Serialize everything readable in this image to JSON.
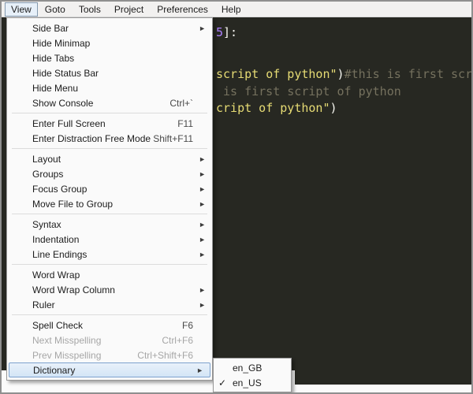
{
  "menubar": {
    "active": "View",
    "items": [
      "View",
      "Goto",
      "Tools",
      "Project",
      "Preferences",
      "Help"
    ]
  },
  "view_menu": {
    "items": [
      {
        "label": "Side Bar",
        "arrow": true
      },
      {
        "label": "Hide Minimap"
      },
      {
        "label": "Hide Tabs"
      },
      {
        "label": "Hide Status Bar"
      },
      {
        "label": "Hide Menu"
      },
      {
        "label": "Show Console",
        "shortcut": "Ctrl+`"
      },
      {
        "separator": true
      },
      {
        "label": "Enter Full Screen",
        "shortcut": "F11"
      },
      {
        "label": "Enter Distraction Free Mode",
        "shortcut": "Shift+F11"
      },
      {
        "separator": true
      },
      {
        "label": "Layout",
        "arrow": true
      },
      {
        "label": "Groups",
        "arrow": true
      },
      {
        "label": "Focus Group",
        "arrow": true
      },
      {
        "label": "Move File to Group",
        "arrow": true
      },
      {
        "separator": true
      },
      {
        "label": "Syntax",
        "arrow": true
      },
      {
        "label": "Indentation",
        "arrow": true
      },
      {
        "label": "Line Endings",
        "arrow": true
      },
      {
        "separator": true
      },
      {
        "label": "Word Wrap"
      },
      {
        "label": "Word Wrap Column",
        "arrow": true
      },
      {
        "label": "Ruler",
        "arrow": true
      },
      {
        "separator": true
      },
      {
        "label": "Spell Check",
        "shortcut": "F6"
      },
      {
        "label": "Next Misspelling",
        "shortcut": "Ctrl+F6",
        "disabled": true
      },
      {
        "label": "Prev Misspelling",
        "shortcut": "Ctrl+Shift+F6",
        "disabled": true
      },
      {
        "label": "Dictionary",
        "arrow": true,
        "highlighted": true
      }
    ]
  },
  "dictionary_submenu": {
    "items": [
      {
        "label": "en_GB",
        "checked": false
      },
      {
        "label": "en_US",
        "checked": true
      }
    ],
    "check_glyph": "✓"
  },
  "editor": {
    "background": "#272822",
    "code_lines": [
      {
        "segments": [
          {
            "text": "5",
            "color": "#ae81ff"
          },
          {
            "text": "]:",
            "color": "#f8f8f2"
          }
        ]
      },
      {
        "segments": [
          {
            "text": "script of python\"",
            "color": "#e6db74"
          },
          {
            "text": ")",
            "color": "#f8f8f2"
          },
          {
            "text": "#this is first scr",
            "color": "#75715e"
          }
        ]
      },
      {
        "segments": [
          {
            "text": "is first script of python",
            "color": "#75715e"
          }
        ]
      },
      {
        "segments": [
          {
            "text": "cript of python\"",
            "color": "#e6db74"
          },
          {
            "text": ")",
            "color": "#f8f8f2"
          }
        ]
      }
    ]
  },
  "icons": {
    "submenu_arrow": "►"
  }
}
